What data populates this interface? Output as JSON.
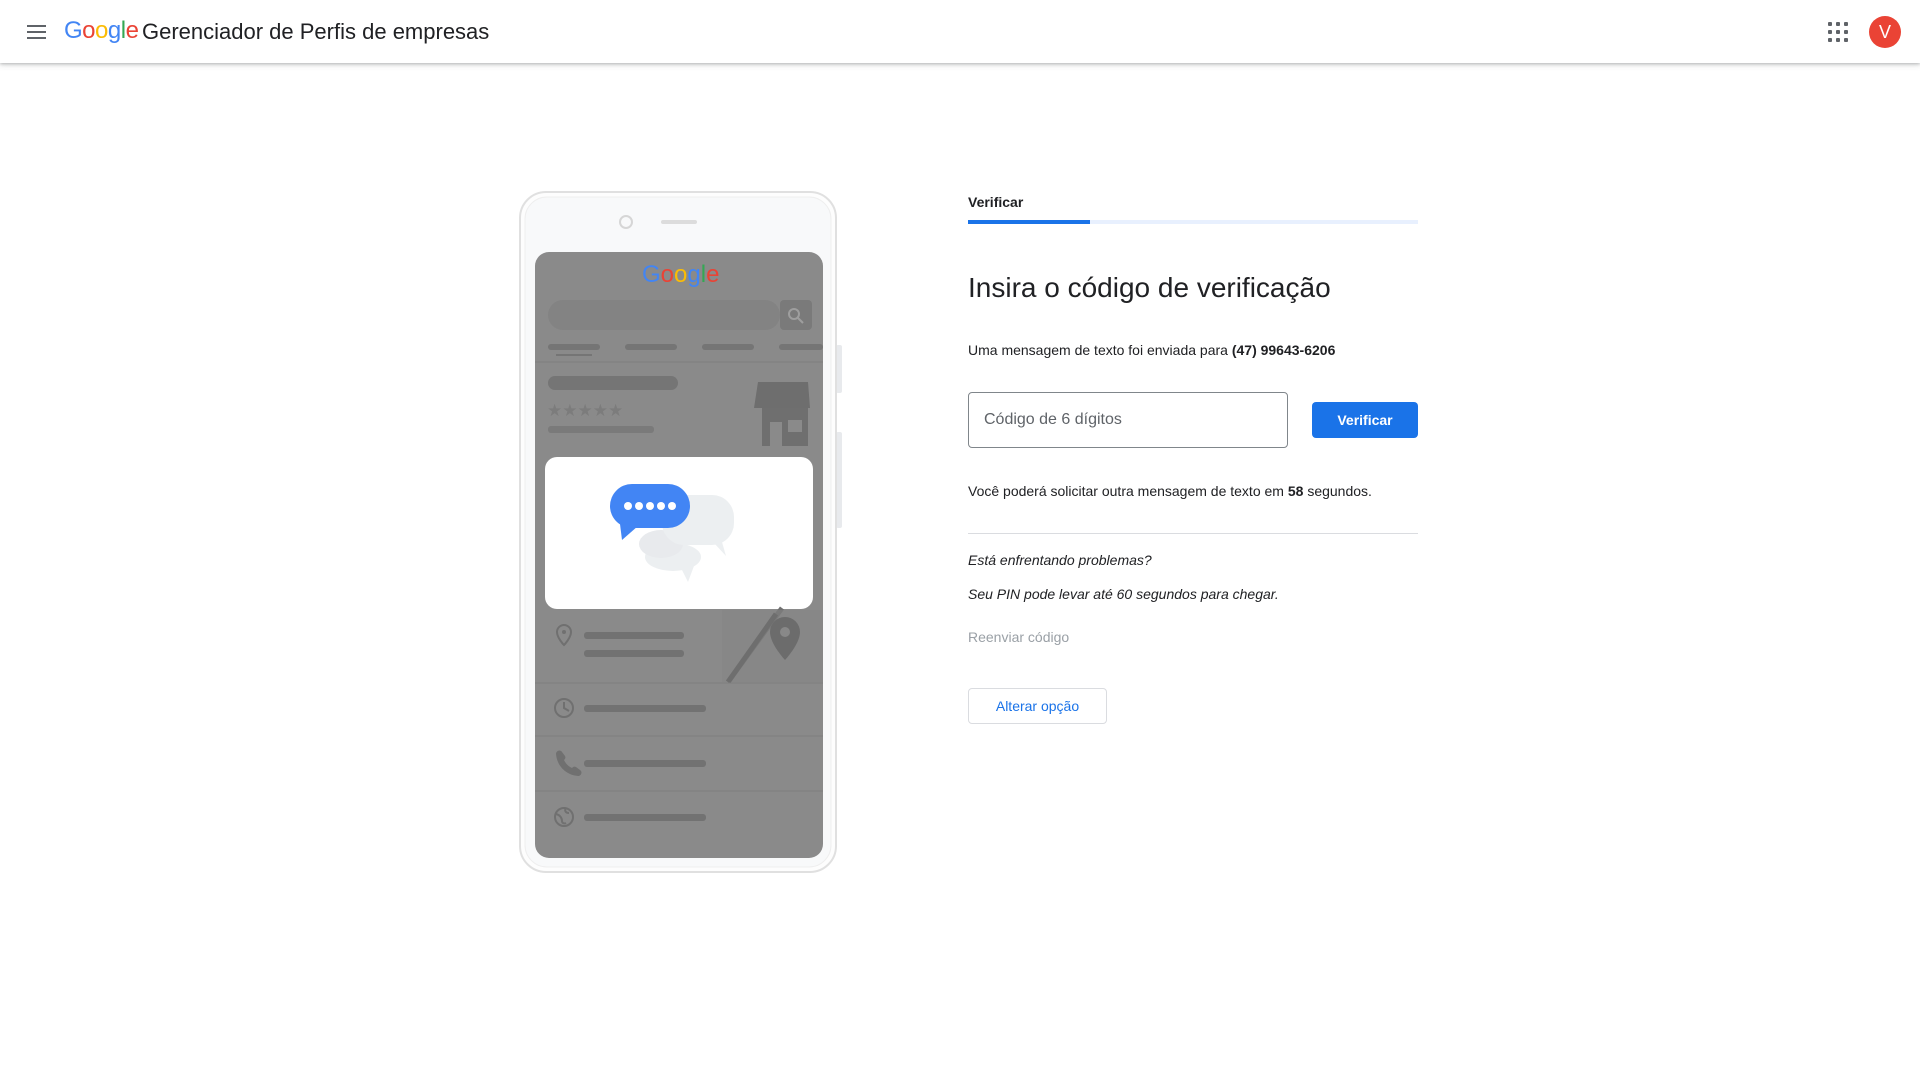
{
  "header": {
    "logo_text": "Google",
    "app_title": "Gerenciador de Perfis de empresas",
    "avatar_initial": "V"
  },
  "illustration": {
    "google_wordmark": "Google",
    "icons": [
      "store-icon",
      "chat-bubble-icon",
      "location-pin-icon",
      "clock-icon",
      "phone-icon",
      "globe-icon",
      "search-icon",
      "star-icon"
    ]
  },
  "verify": {
    "step_label": "Verificar",
    "progress_fraction": 0.27,
    "heading": "Insira o código de verificação",
    "sent_text": "Uma mensagem de texto foi enviada para",
    "phone_number": "(47) 99643-6206",
    "code_placeholder": "Código de 6 dígitos",
    "code_value": "",
    "verify_button": "Verificar",
    "countdown_prefix": "Você poderá solicitar outra mensagem de texto em",
    "countdown_seconds": "58",
    "countdown_suffix": "segundos.",
    "problems_text": "Está enfrentando problemas?",
    "pin_note": "Seu PIN pode levar até 60 segundos para chegar.",
    "resend_label": "Reenviar código",
    "change_option_label": "Alterar opção"
  },
  "colors": {
    "accent": "#1a73e8",
    "avatar_bg": "#ea4335",
    "progress_track": "#e8f0fe"
  }
}
